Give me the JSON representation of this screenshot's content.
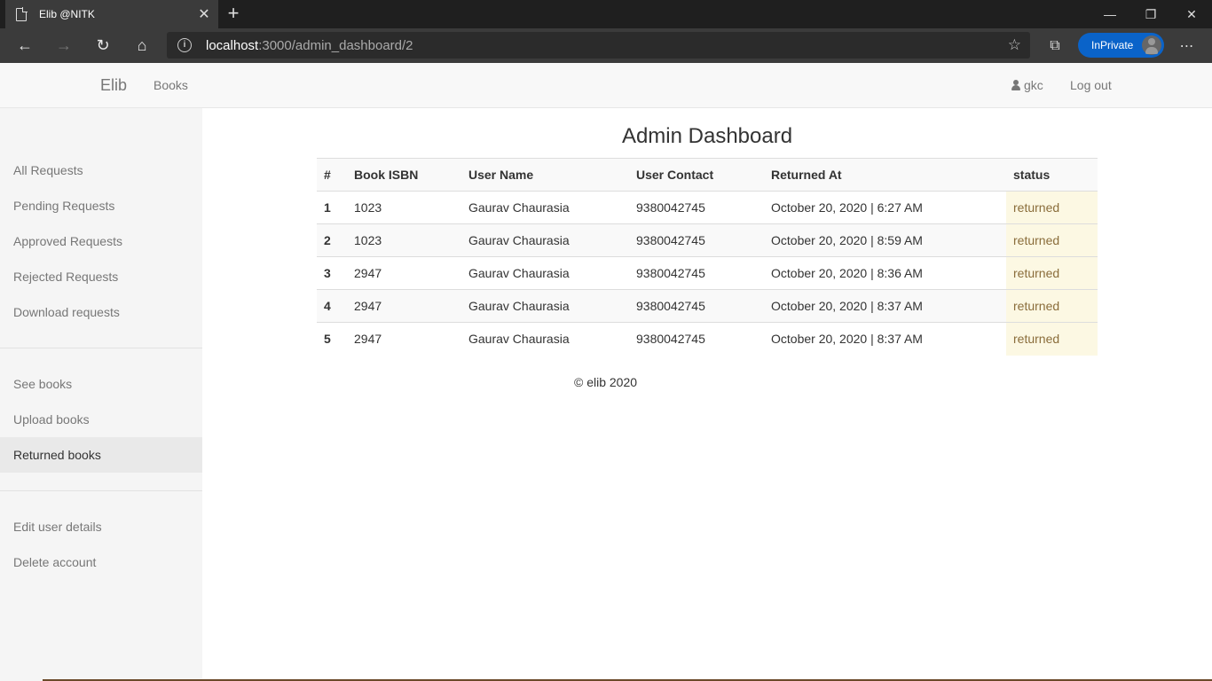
{
  "browser": {
    "tab_title": "Elib @NITK",
    "url_host": "localhost",
    "url_path": ":3000/admin_dashboard/2",
    "inprivate_label": "InPrivate"
  },
  "navbar": {
    "brand": "Elib",
    "books": "Books",
    "user": "gkc",
    "logout": "Log out"
  },
  "sidebar": {
    "group1": [
      "All Requests",
      "Pending Requests",
      "Approved Requests",
      "Rejected Requests",
      "Download requests"
    ],
    "group2": [
      "See books",
      "Upload books",
      "Returned books"
    ],
    "group3": [
      "Edit user details",
      "Delete account"
    ],
    "active": "Returned books"
  },
  "main": {
    "title": "Admin Dashboard",
    "columns": [
      "#",
      "Book ISBN",
      "User Name",
      "User Contact",
      "Returned At",
      "status"
    ],
    "rows": [
      {
        "num": "1",
        "isbn": "1023",
        "name": "Gaurav Chaurasia",
        "contact": "9380042745",
        "returned": "October 20, 2020 | 6:27 AM",
        "status": "returned"
      },
      {
        "num": "2",
        "isbn": "1023",
        "name": "Gaurav Chaurasia",
        "contact": "9380042745",
        "returned": "October 20, 2020 | 8:59 AM",
        "status": "returned"
      },
      {
        "num": "3",
        "isbn": "2947",
        "name": "Gaurav Chaurasia",
        "contact": "9380042745",
        "returned": "October 20, 2020 | 8:36 AM",
        "status": "returned"
      },
      {
        "num": "4",
        "isbn": "2947",
        "name": "Gaurav Chaurasia",
        "contact": "9380042745",
        "returned": "October 20, 2020 | 8:37 AM",
        "status": "returned"
      },
      {
        "num": "5",
        "isbn": "2947",
        "name": "Gaurav Chaurasia",
        "contact": "9380042745",
        "returned": "October 20, 2020 | 8:37 AM",
        "status": "returned"
      }
    ],
    "footer": "© elib 2020"
  },
  "colors": {
    "status_bg": "#fcf8e3",
    "status_text": "#8a6d3b",
    "inprivate_badge": "#0a63c9"
  }
}
